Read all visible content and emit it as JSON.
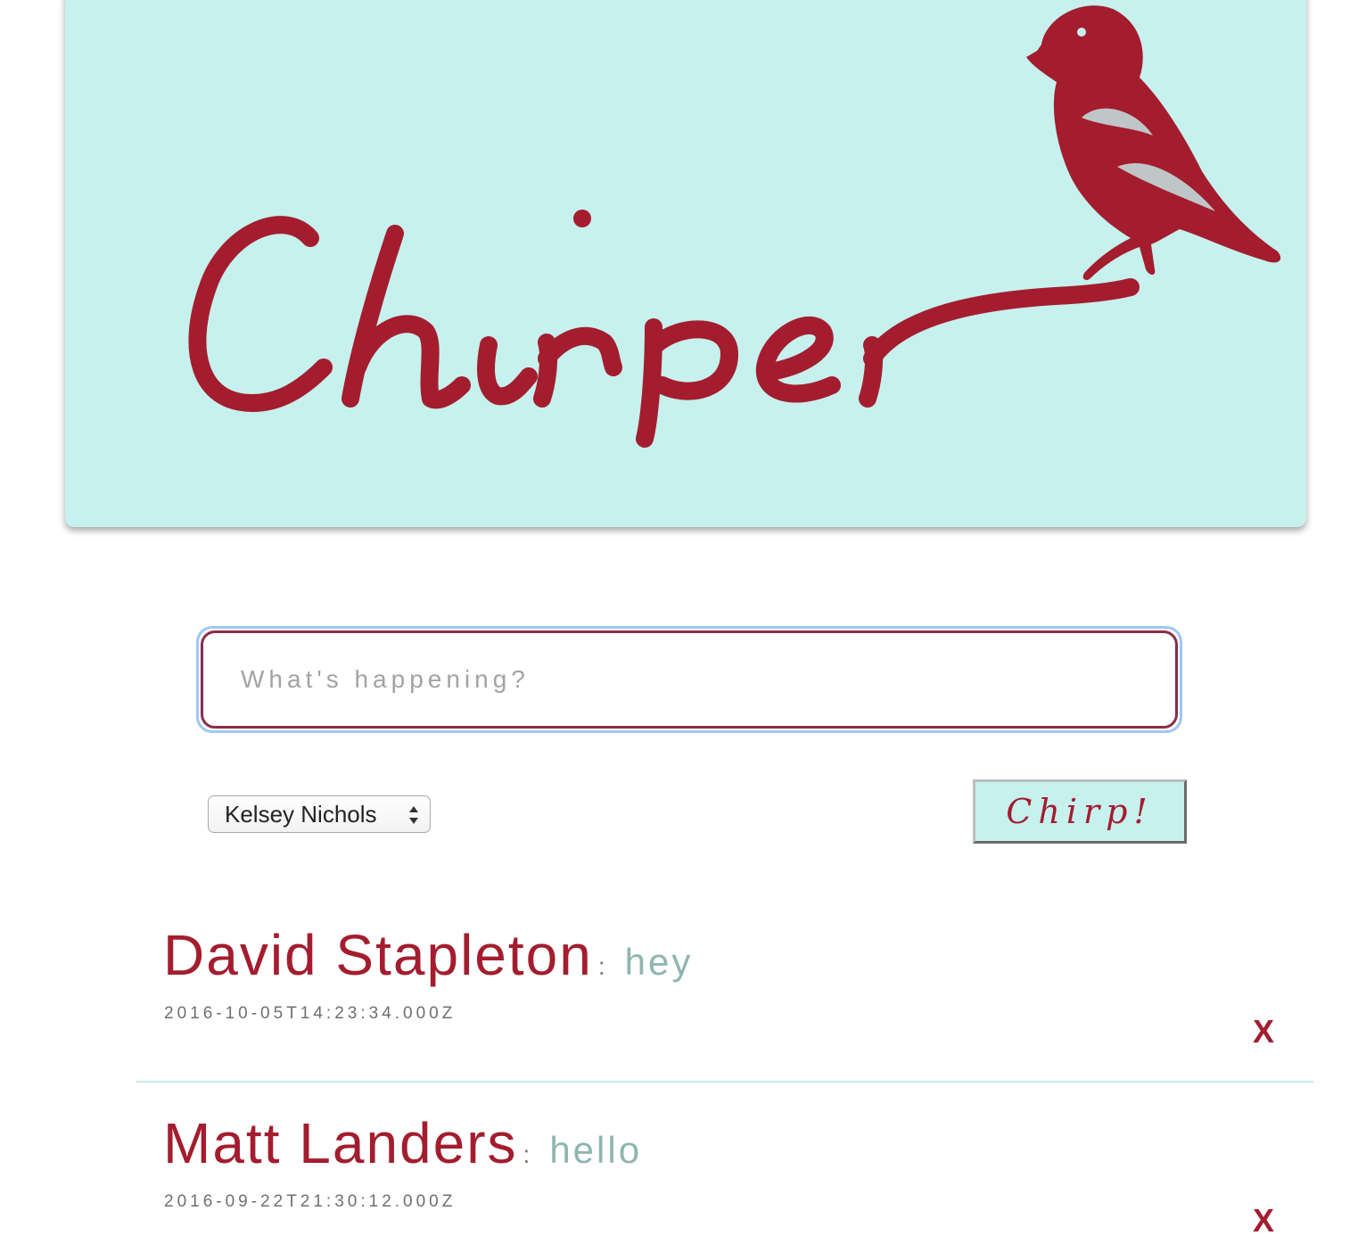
{
  "header": {
    "logo_text": "Chirper",
    "brand_color": "#a31d2e",
    "banner_color": "#c6f1ee",
    "logo_icon": "bird-icon"
  },
  "compose": {
    "placeholder": "What's happening?",
    "value": "",
    "selected_user": "Kelsey Nichols",
    "submit_label": "Chirp!"
  },
  "feed": [
    {
      "user": "David Stapleton",
      "separator": ":",
      "message": "hey",
      "timestamp": "2016-10-05T14:23:34.000Z",
      "delete_label": "X"
    },
    {
      "user": "Matt Landers",
      "separator": ":",
      "message": "hello",
      "timestamp": "2016-09-22T21:30:12.000Z",
      "delete_label": "X"
    }
  ]
}
